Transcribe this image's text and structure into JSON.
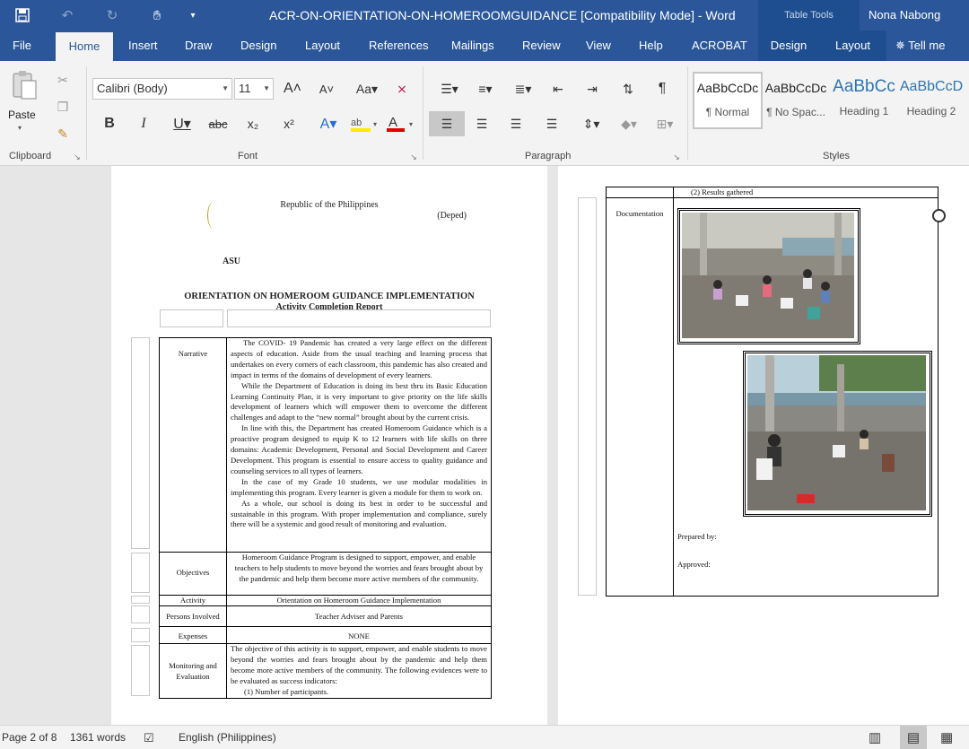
{
  "window": {
    "title": "ACR-ON-ORIENTATION-ON-HOMEROOMGUIDANCE [Compatibility Mode]  -  Word",
    "context_group": "Table Tools",
    "user": "Nona Nabong"
  },
  "tabs": [
    "File",
    "Home",
    "Insert",
    "Draw",
    "Design",
    "Layout",
    "References",
    "Mailings",
    "Review",
    "View",
    "Help",
    "ACROBAT"
  ],
  "context_tabs": [
    "Design",
    "Layout"
  ],
  "tell_me": "Tell me",
  "ribbon": {
    "clipboard": {
      "paste": "Paste",
      "label": "Clipboard"
    },
    "font": {
      "name": "Calibri (Body)",
      "size": "11",
      "label": "Font"
    },
    "paragraph": {
      "label": "Paragraph"
    },
    "styles": {
      "label": "Styles",
      "items": [
        {
          "sample": "AaBbCcDc",
          "name": "¶ Normal"
        },
        {
          "sample": "AaBbCcDc",
          "name": "¶ No Spac..."
        },
        {
          "sample": "AaBbCc",
          "name": "Heading 1"
        },
        {
          "sample": "AaBbCcD",
          "name": "Heading 2"
        }
      ]
    }
  },
  "document": {
    "header": {
      "republic": "Republic of the Philippines",
      "deped": "(Deped)",
      "school_fragment": "ASU"
    },
    "title": "ORIENTATION ON HOMEROOM GUIDANCE IMPLEMENTATION",
    "subtitle": "Activity Completion Report",
    "rows": {
      "narrative": {
        "label": "Narrative",
        "paragraphs": [
          "The COVID- 19 Pandemic has created a very large effect on the different aspects of education. Aside from the usual teaching and learning process that undertakes on every corners of each classroom, this pandemic has also created and impact in terms of the domains of development of every learners.",
          "While the Department of Education is doing its best thru its Basic Education Learning Continuity Plan, it is very important to give priority on the life skills development of learners which will empower them to overcome the different challenges and adapt to the “new normal” brought about by the current crisis.",
          "In line with this, the Department has created Homeroom Guidance which is a proactive program designed to equip K to 12 learners with life skills on three domains: Academic Development, Personal and Social Development and Career Development. This program is essential to ensure access to quality guidance and counseling services to all types of learners.",
          "In the case of my Grade 10 students, we use modular modalities in implementing this program. Every learner is given a module for them to work on.",
          "As a whole, our school is doing its best in order to be successful and sustainable in this program. With proper implementation and compliance, surely there will be a systemic and good result of monitoring and evaluation."
        ]
      },
      "objectives": {
        "label": "Objectives",
        "text": "Homeroom Guidance Program is designed to support, empower, and enable teachers to help students to move beyond the worries and fears brought about by the pandemic and help them become more active members of the community."
      },
      "activity": {
        "label": "Activity",
        "text": "Orientation on Homeroom Guidance Implementation"
      },
      "persons": {
        "label": "Persons Involved",
        "text": "Teacher Adviser and Parents"
      },
      "expenses": {
        "label": "Expenses",
        "text": "NONE"
      },
      "monitoring": {
        "label": "Monitoring and Evaluation",
        "text": "The objective of this activity is to support, empower, and enable students to move beyond the worries and fears brought about by the pandemic and help them become more active members of the community. The following evidences were to be evaluated as success indicators:",
        "item1": "(1)  Number of participants."
      }
    },
    "page2": {
      "item2": "(2)  Results gathered",
      "documentation": "Documentation",
      "prepared_by": "Prepared by:",
      "approved": "Approved:"
    }
  },
  "status": {
    "page": "Page 2 of 8",
    "words": "1361 words",
    "language": "English (Philippines)"
  }
}
